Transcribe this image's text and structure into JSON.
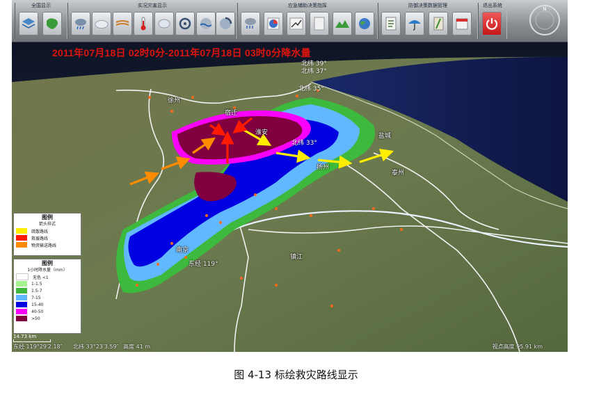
{
  "toolbar": {
    "groups": [
      {
        "label": "全国显示",
        "buttons": [
          "globe-layers-icon",
          "china-map-icon"
        ]
      },
      {
        "label": "实况灾害显示",
        "buttons": [
          "rain-cloud-icon",
          "cloud-icon",
          "wind-icon",
          "thermometer-icon",
          "hail-icon",
          "typhoon-icon",
          "flood-icon",
          "storm-icon"
        ]
      },
      {
        "label": "应急辅助决策指挥",
        "buttons": [
          "rainfall-icon",
          "pie-chart-icon",
          "trend-chart-icon",
          "document-icon",
          "terrain-icon",
          "earth-icon"
        ]
      },
      {
        "label": "防御决策数据管理",
        "buttons": [
          "report-icon",
          "umbrella-icon",
          "notebook-icon",
          "calendar-icon"
        ]
      },
      {
        "label": "退出系统",
        "buttons": [
          "power-icon"
        ]
      }
    ]
  },
  "headline": "2011年07月18日  02时0分-2011年07月18日  03时0分降水量",
  "map_labels": {
    "cities": [
      "徐州",
      "宿迁",
      "淮安",
      "盐城",
      "扬州",
      "泰州",
      "南京",
      "镇江"
    ],
    "latitudes": [
      "北纬 39°",
      "北纬 37°",
      "北纬 35°",
      "北纬 33°"
    ],
    "meridian": "东经 119°"
  },
  "arrow_legend": {
    "title": "图例",
    "subtitle": "箭头样式",
    "items": [
      {
        "label": "疏散路线",
        "color": "#ffee00"
      },
      {
        "label": "救援路线",
        "color": "#ff1a00"
      },
      {
        "label": "物资输送路线",
        "color": "#ff8c00"
      }
    ]
  },
  "rain_legend": {
    "title": "图例",
    "subtitle": "1小时降水量（mm）",
    "items": [
      {
        "color": "#ffffff",
        "label": "无色    <1"
      },
      {
        "color": "#a6f28f",
        "label": "1-1.5"
      },
      {
        "color": "#3dba3d",
        "label": "1.5-7"
      },
      {
        "color": "#61b8ff",
        "label": "7-15"
      },
      {
        "color": "#0000e1",
        "label": "15-40"
      },
      {
        "color": "#fa00fa",
        "label": "40-50"
      },
      {
        "color": "#800040",
        "label": ">50"
      }
    ]
  },
  "status": {
    "scale": "14.73 km",
    "lon": "东经 119°29′2.18″",
    "lat": "北纬 33°23′3.59″",
    "elev": "高度 41 m",
    "eye": "视点高度 95.91 km"
  },
  "caption": "图  4-13 标绘救灾路线显示"
}
